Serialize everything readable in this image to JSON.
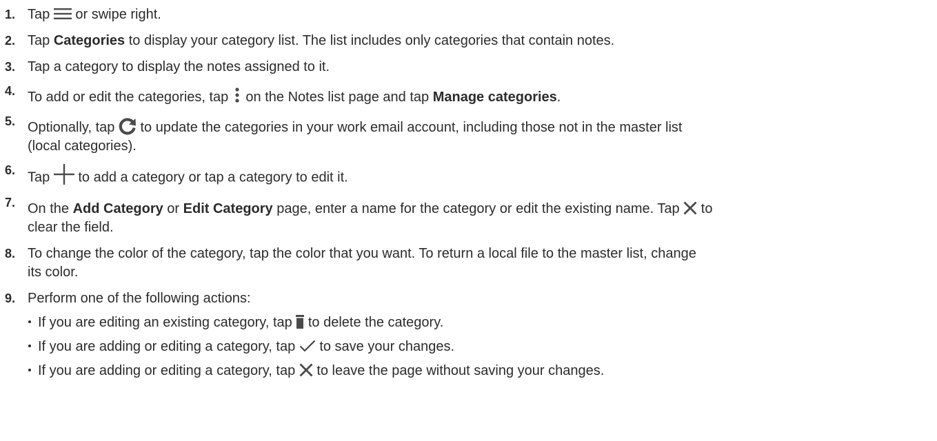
{
  "steps": [
    {
      "num": "1.",
      "p1": "Tap ",
      "p2": " or swipe right."
    },
    {
      "num": "2.",
      "p1": "Tap ",
      "b1": "Categories",
      "p2": " to display your category list. The list includes only categories that contain notes."
    },
    {
      "num": "3.",
      "p1": "Tap a category to display the notes assigned to it."
    },
    {
      "num": "4.",
      "p1": "To add or edit the categories, tap ",
      "p2": " on the Notes list page and tap ",
      "b1": "Manage categories",
      "p3": "."
    },
    {
      "num": "5.",
      "p1": "Optionally, tap ",
      "p2": " to update the categories in your work email account, including those not in the master list",
      "p3": "(local categories)."
    },
    {
      "num": "6.",
      "p1": "Tap ",
      "p2": " to add a category or tap a category to edit it."
    },
    {
      "num": "7.",
      "p1": "On the ",
      "b1": "Add Category ",
      "p2": " or ",
      "b2": "Edit Category",
      "p3": " page, enter a name for the category or edit the existing name. Tap ",
      "p4": " to",
      "p5": "clear the field."
    },
    {
      "num": "8.",
      "p1": "To change the color of the category, tap the color that you want. To return a local file to the master list, change",
      "p2": "its color."
    },
    {
      "num": "9.",
      "p1": "Perform one of the following actions:"
    }
  ],
  "bullets": [
    {
      "p1": "If you are editing an existing category, tap ",
      "p2": " to delete the category."
    },
    {
      "p1": "If you are adding or editing a category, tap ",
      "p2": " to save your changes."
    },
    {
      "p1": "If you are adding or editing a category, tap ",
      "p2": " to leave the page without saving your changes."
    }
  ],
  "icons": {
    "menu": "hamburger-menu-icon",
    "more": "vertical-ellipsis-icon",
    "refresh": "refresh-icon",
    "add": "plus-icon",
    "clear": "close-x-icon",
    "delete": "trash-icon",
    "save": "checkmark-icon",
    "cancel": "close-x-icon"
  },
  "colors": {
    "text": "#2b2b2b",
    "icon": "#4a4a4a",
    "check": "#3a3a3a"
  }
}
